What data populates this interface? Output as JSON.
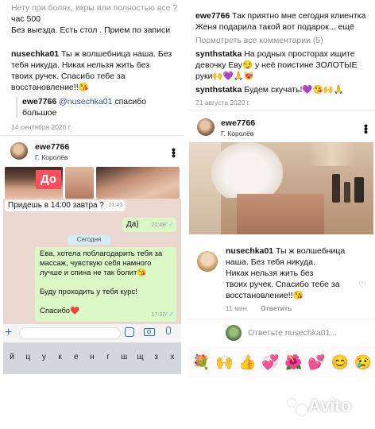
{
  "left": {
    "top_comment": {
      "line1": "Нету при болях, икры или полностью все ?",
      "line2": "час 500",
      "line3": "Без выезда. Есть стол . Прием по записи"
    },
    "nusechka_comment": {
      "author": "nusechka01",
      "text_lines": [
        "Ты ж волшебница наша. Без",
        "тебя никуда. Никак нельзя жить без",
        "твоих ручек. Спасибо тебе за",
        "восстановление!!😘"
      ]
    },
    "ewe_reply": {
      "author": "ewe7766",
      "mention": "@nusechka01",
      "text_line1": "спасибо",
      "text_line2": "большое"
    },
    "date1": "14 сентября 2020 г.",
    "post": {
      "author": "ewe7766",
      "location": "Г. Королёв",
      "before_label": "До"
    },
    "chat": {
      "msg1": "Придешь в 14:00 завтра ?",
      "msg1_time": "21:43",
      "msg2": "Да)",
      "msg2_time": "21:49",
      "date_badge": "Сегодня",
      "msg3_lines": [
        "Ева, хотела поблагодарить тебя за",
        "массаж, чувствую себя намного",
        "лучше и спина не так болит😘",
        "",
        "Буду проходить у тебя курс!",
        "",
        "Спасибо❤️"
      ],
      "msg3_time": "17:37"
    },
    "keyboard_row": [
      "й",
      "ц",
      "у",
      "к",
      "е",
      "н",
      "г",
      "ш",
      "щ",
      "з",
      "х"
    ]
  },
  "right": {
    "comment1": {
      "author": "ewe7766",
      "text_lines": [
        "Так приятно мне сегодня клиентка",
        "Женя подарила такой вот подарок... ещё"
      ]
    },
    "view_all": "Посмотреть все комментарии (5)",
    "comment2": {
      "author": "synthstatka",
      "text_lines": [
        "На родных просторах ищите",
        "девочку Еву😏 у неё поистине ЗОЛОТЫЕ",
        "руки🙌💜🙏😻"
      ]
    },
    "comment3": {
      "author": "synthstatka",
      "text": "Будем скучать!💜😘🙌🙏"
    },
    "date2": "21 августа 2020 г.",
    "post": {
      "author": "ewe7766",
      "location": "Г. Королёв"
    },
    "comment4": {
      "author": "nusechka01",
      "text_lines": [
        "Ты ж волшебница",
        "наша. Без тебя никуда.",
        "Никак нельзя жить без",
        "твоих ручек. Спасибо тебе за",
        "восстановление!!😘"
      ],
      "time": "11 мин.",
      "reply": "Ответить"
    },
    "reply_placeholder": "Ответьте nusechka01...",
    "emoji_row": [
      "💐",
      "🙌",
      "👍",
      "💞",
      "🌺",
      "💕",
      "😊",
      "😢"
    ]
  },
  "watermark": "Avito"
}
